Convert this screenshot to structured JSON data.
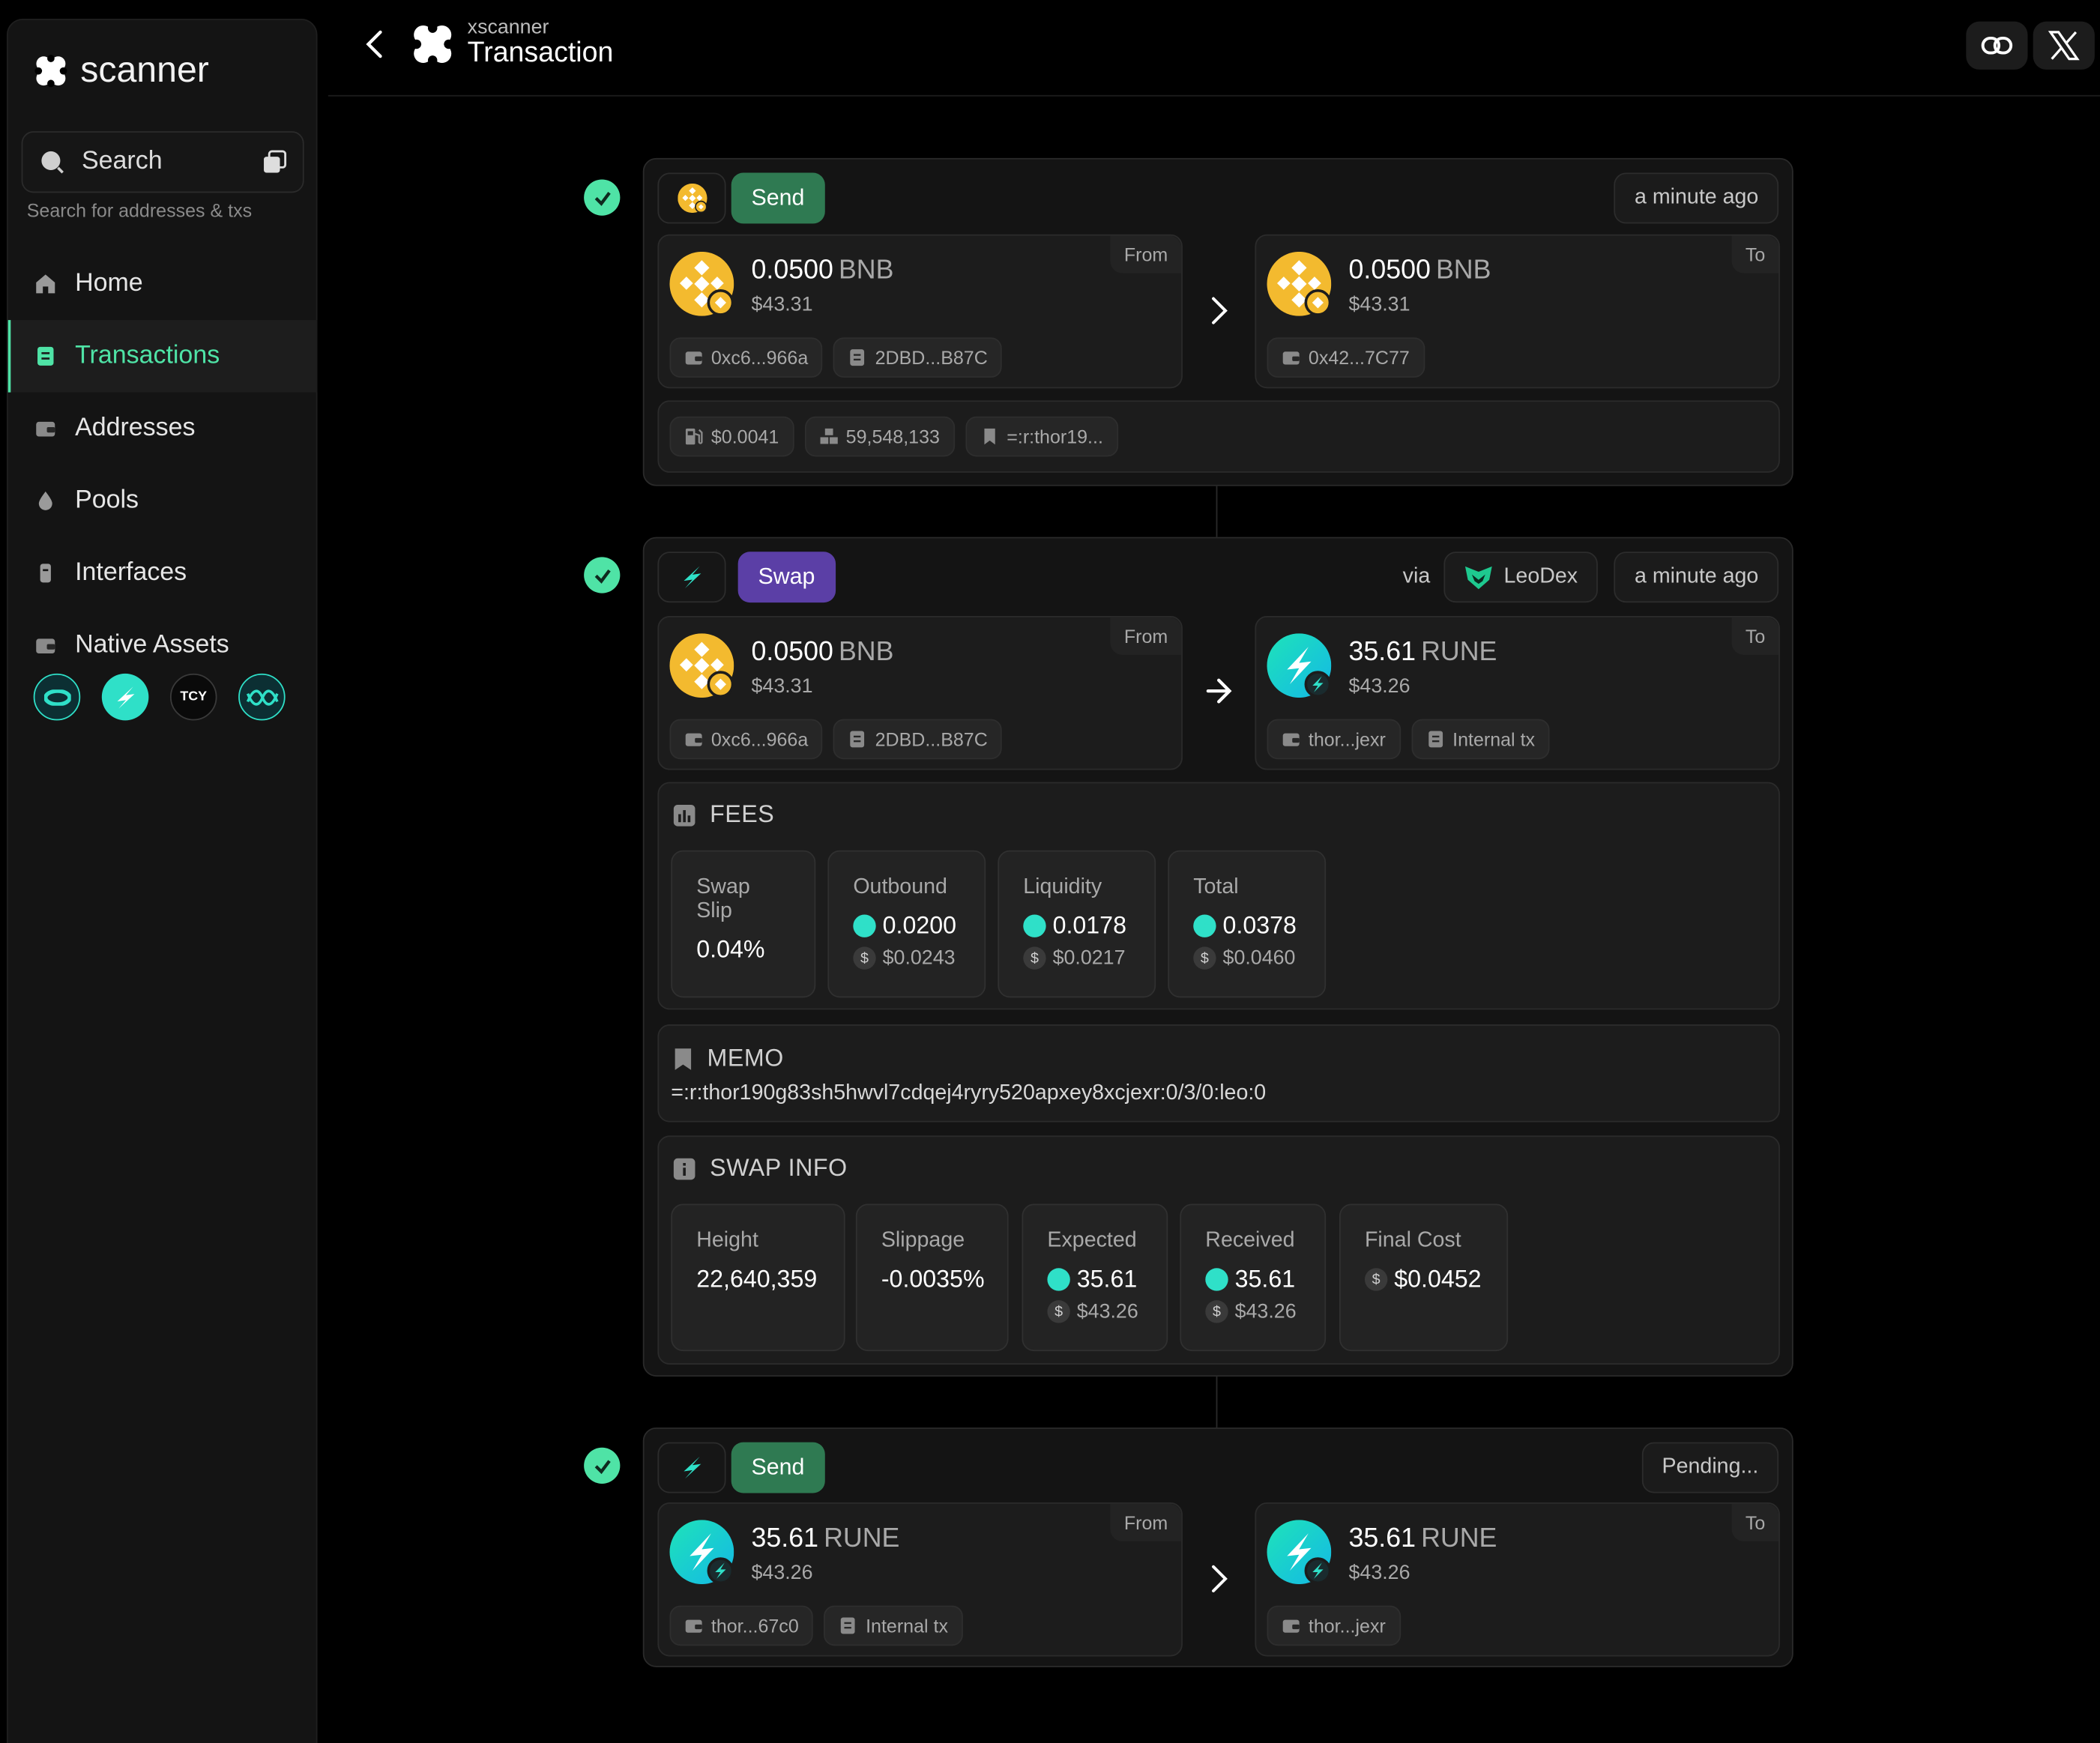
{
  "sidebar": {
    "logo_text": "scanner",
    "search_placeholder": "Search",
    "search_hint": "Search for addresses & txs",
    "nav": [
      {
        "label": "Home",
        "icon": "home-icon"
      },
      {
        "label": "Transactions",
        "icon": "receipt-icon",
        "active": true
      },
      {
        "label": "Addresses",
        "icon": "wallet-icon"
      },
      {
        "label": "Pools",
        "icon": "drop-icon"
      },
      {
        "label": "Interfaces",
        "icon": "device-icon"
      },
      {
        "label": "Native Assets",
        "icon": "wallet-icon"
      }
    ],
    "asset_tcy": "TCY"
  },
  "header": {
    "subtitle": "xscanner",
    "title": "Transaction"
  },
  "colors": {
    "accent": "#4fe3a6",
    "send": "#2f7a52",
    "swap": "#5b3fa6",
    "bnb": "#f3ba2f",
    "rune": "#2fe0c8"
  },
  "actions": [
    {
      "type": "Send",
      "time": "a minute ago",
      "from": {
        "amount": "0.0500",
        "symbol": "BNB",
        "usd": "$43.31",
        "tag": "From",
        "chips": [
          "0xc6...966a",
          "2DBD...B87C"
        ]
      },
      "to": {
        "amount": "0.0500",
        "symbol": "BNB",
        "usd": "$43.31",
        "tag": "To",
        "chips": [
          "0x42...7C77"
        ]
      },
      "meta": [
        "$0.0041",
        "59,548,133",
        "=:r:thor19..."
      ]
    },
    {
      "type": "Swap",
      "time": "a minute ago",
      "via_label": "via",
      "via_name": "LeoDex",
      "from": {
        "amount": "0.0500",
        "symbol": "BNB",
        "usd": "$43.31",
        "tag": "From",
        "chips": [
          "0xc6...966a",
          "2DBD...B87C"
        ]
      },
      "to": {
        "amount": "35.61",
        "symbol": "RUNE",
        "usd": "$43.26",
        "tag": "To",
        "chips": [
          "thor...jexr",
          "Internal tx"
        ]
      },
      "fees": {
        "title": "FEES",
        "items": [
          {
            "label": "Swap Slip",
            "value": "0.04%"
          },
          {
            "label": "Outbound",
            "value": "0.0200",
            "usd": "$0.0243"
          },
          {
            "label": "Liquidity",
            "value": "0.0178",
            "usd": "$0.0217"
          },
          {
            "label": "Total",
            "value": "0.0378",
            "usd": "$0.0460"
          }
        ]
      },
      "memo": {
        "title": "MEMO",
        "text": "=:r:thor190g83sh5hwvl7cdqej4ryry520apxey8xcjexr:0/3/0:leo:0"
      },
      "swap_info": {
        "title": "SWAP INFO",
        "items": [
          {
            "label": "Height",
            "value": "22,640,359"
          },
          {
            "label": "Slippage",
            "value": "-0.0035%"
          },
          {
            "label": "Expected",
            "value": "35.61",
            "usd": "$43.26"
          },
          {
            "label": "Received",
            "value": "35.61",
            "usd": "$43.26"
          },
          {
            "label": "Final Cost",
            "value": "$0.0452"
          }
        ]
      }
    },
    {
      "type": "Send",
      "time": "Pending...",
      "from": {
        "amount": "35.61",
        "symbol": "RUNE",
        "usd": "$43.26",
        "tag": "From",
        "chips": [
          "thor...67c0",
          "Internal tx"
        ]
      },
      "to": {
        "amount": "35.61",
        "symbol": "RUNE",
        "usd": "$43.26",
        "tag": "To",
        "chips": [
          "thor...jexr"
        ]
      }
    }
  ]
}
